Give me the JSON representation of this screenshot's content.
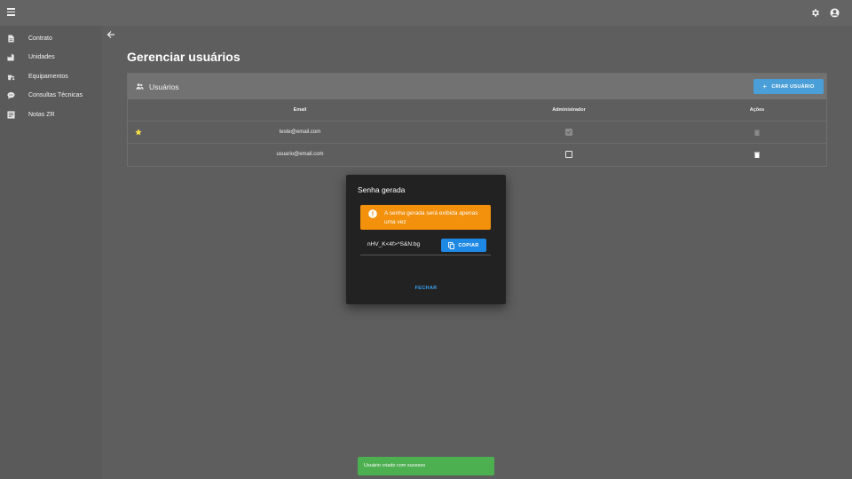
{
  "sidebar": {
    "items": [
      {
        "label": "Contrato",
        "icon": "document-icon"
      },
      {
        "label": "Unidades",
        "icon": "factory-icon"
      },
      {
        "label": "Equipamentos",
        "icon": "tractor-icon"
      },
      {
        "label": "Consultas Técnicas",
        "icon": "chat-icon"
      },
      {
        "label": "Notas ZR",
        "icon": "notes-icon"
      }
    ]
  },
  "page": {
    "title": "Gerenciar usuários"
  },
  "users_card": {
    "title": "Usuários",
    "create_button": "CRIAR USUÁRIO",
    "columns": [
      "Email",
      "Administrador",
      "Ações"
    ],
    "rows": [
      {
        "email": "teste@email.com",
        "administrador": true,
        "current_user": true
      },
      {
        "email": "usuario@email.com",
        "administrador": false,
        "current_user": false
      }
    ]
  },
  "dialog": {
    "title": "Senha gerada",
    "warning": "A senha gerada será exibida apenas uma vez",
    "password": "nHV_K<4f>^S&N:bg",
    "copy_button": "COPIAR",
    "close_button": "FECHAR"
  },
  "snackbar": {
    "message": "Usuário criado com sucesso"
  },
  "colors": {
    "accent": "#4a9fd8",
    "warning": "#f3900c",
    "success": "#4caf50",
    "star": "#f5e04a"
  }
}
